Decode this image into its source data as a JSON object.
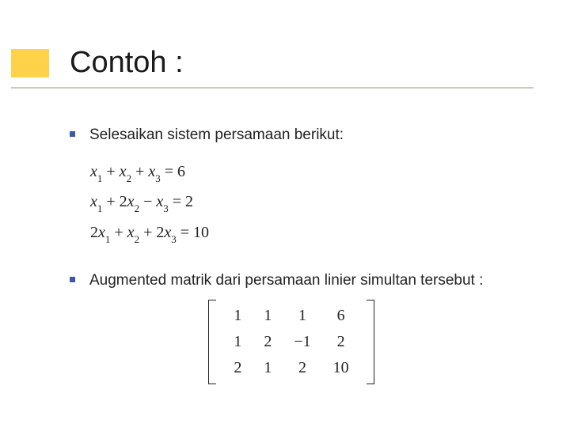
{
  "title": "Contoh :",
  "bullets": {
    "b1": "Selesaikan sistem persamaan berikut:",
    "b2": "Augmented matrik dari persamaan linier simultan tersebut :"
  },
  "equations": {
    "e1": {
      "x1c": "x",
      "x1s": "1",
      "p1": " + ",
      "x2c": "x",
      "x2s": "2",
      "p2": " + ",
      "x3c": "x",
      "x3s": "3",
      "eq": " = 6"
    },
    "e2": {
      "x1c": "x",
      "x1s": "1",
      "p1": " + 2",
      "x2c": "x",
      "x2s": "2",
      "p2": " − ",
      "x3c": "x",
      "x3s": "3",
      "eq": " = 2"
    },
    "e3": {
      "c1": "2",
      "x1c": "x",
      "x1s": "1",
      "p1": " + ",
      "x2c": "x",
      "x2s": "2",
      "p2": " + 2",
      "x3c": "x",
      "x3s": "3",
      "eq": " = 10"
    }
  },
  "matrix": {
    "r0": {
      "c0": "1",
      "c1": "1",
      "c2": "1",
      "c3": "6"
    },
    "r1": {
      "c0": "1",
      "c1": "2",
      "c2": "−1",
      "c3": "2"
    },
    "r2": {
      "c0": "2",
      "c1": "1",
      "c2": "2",
      "c3": "10"
    }
  }
}
